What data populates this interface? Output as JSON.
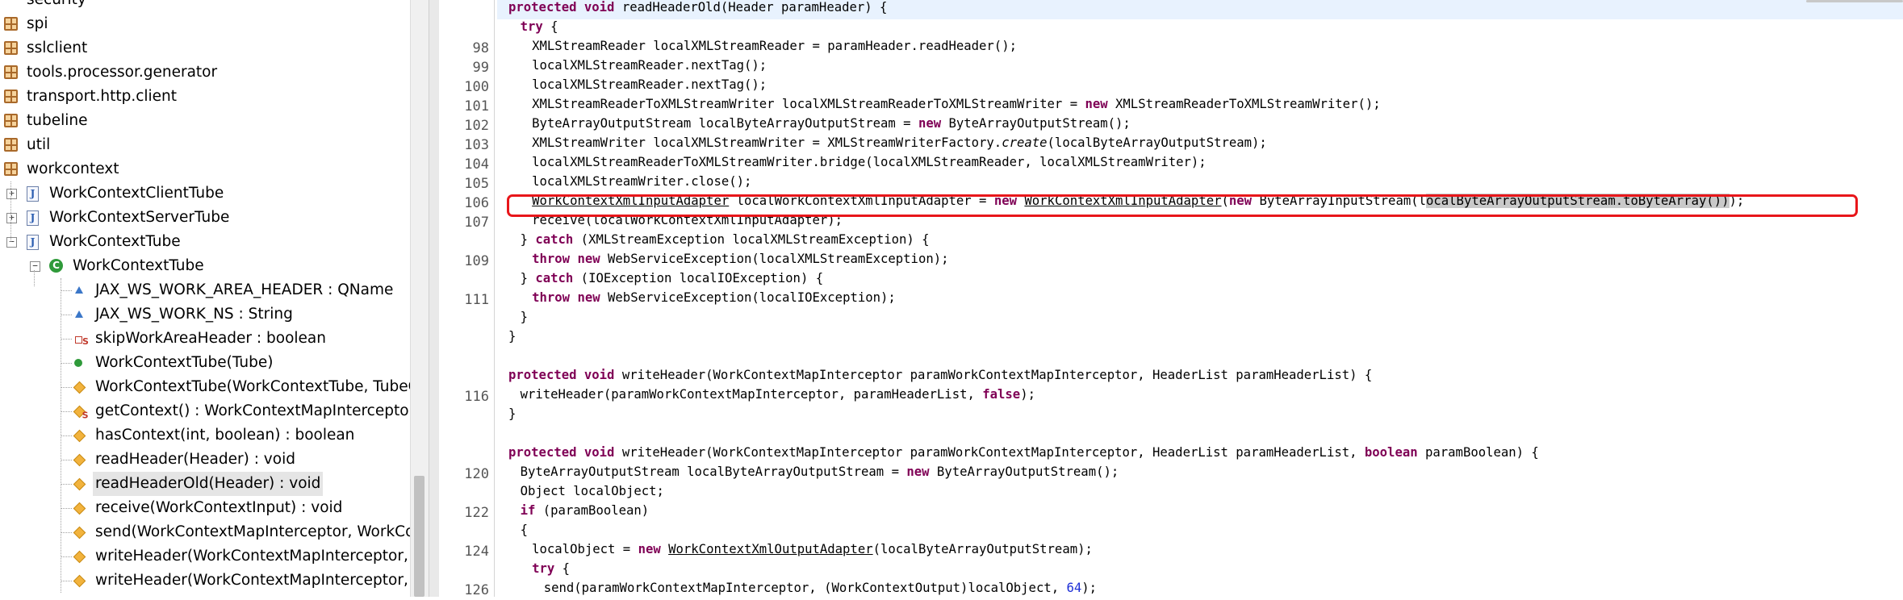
{
  "tree": {
    "items": [
      {
        "label": "security",
        "kind": "package",
        "cut": true
      },
      {
        "label": "spi",
        "kind": "package"
      },
      {
        "label": "sslclient",
        "kind": "package"
      },
      {
        "label": "tools.processor.generator",
        "kind": "package"
      },
      {
        "label": "transport.http.client",
        "kind": "package"
      },
      {
        "label": "tubeline",
        "kind": "package"
      },
      {
        "label": "util",
        "kind": "package"
      },
      {
        "label": "workcontext",
        "kind": "package"
      },
      {
        "label": "WorkContextClientTube",
        "kind": "java-file",
        "toggle": "+"
      },
      {
        "label": "WorkContextServerTube",
        "kind": "java-file",
        "toggle": "+"
      },
      {
        "label": "WorkContextTube",
        "kind": "java-file",
        "toggle": "-"
      },
      {
        "label": "WorkContextTube",
        "kind": "class",
        "toggle": "-"
      },
      {
        "label": "JAX_WS_WORK_AREA_HEADER : QName",
        "kind": "field-protected"
      },
      {
        "label": "JAX_WS_WORK_NS : String",
        "kind": "field-protected"
      },
      {
        "label": "skipWorkAreaHeader : boolean",
        "kind": "field-private-static"
      },
      {
        "label": "WorkContextTube(Tube)",
        "kind": "constructor-public"
      },
      {
        "label": "WorkContextTube(WorkContextTube, TubeC",
        "kind": "method-protected"
      },
      {
        "label": "getContext() : WorkContextMapInterceptor",
        "kind": "method-protected-static"
      },
      {
        "label": "hasContext(int, boolean) : boolean",
        "kind": "method-protected"
      },
      {
        "label": "readHeader(Header) : void",
        "kind": "method-protected"
      },
      {
        "label": "readHeaderOld(Header) : void",
        "kind": "method-protected",
        "selected": true
      },
      {
        "label": "receive(WorkContextInput) : void",
        "kind": "method-protected"
      },
      {
        "label": "send(WorkContextMapInterceptor, WorkCor",
        "kind": "method-protected"
      },
      {
        "label": "writeHeader(WorkContextMapInterceptor, H",
        "kind": "method-protected"
      },
      {
        "label": "writeHeader(WorkContextMapInterceptor, H",
        "kind": "method-protected"
      }
    ]
  },
  "editor": {
    "lines": [
      {
        "n": "",
        "indent": 0,
        "segs": [
          [
            "kw",
            "protected"
          ],
          [
            "t",
            " "
          ],
          [
            "kw",
            "void"
          ],
          [
            "t",
            " readHeaderOld(Header paramHeader) {"
          ]
        ]
      },
      {
        "n": "",
        "indent": 2,
        "segs": [
          [
            "kw",
            "try"
          ],
          [
            "t",
            " {"
          ]
        ]
      },
      {
        "n": "98",
        "indent": 4,
        "segs": [
          [
            "t",
            "XMLStreamReader localXMLStreamReader = paramHeader.readHeader();"
          ]
        ]
      },
      {
        "n": "99",
        "indent": 4,
        "segs": [
          [
            "t",
            "localXMLStreamReader.nextTag();"
          ]
        ]
      },
      {
        "n": "100",
        "indent": 4,
        "segs": [
          [
            "t",
            "localXMLStreamReader.nextTag();"
          ]
        ]
      },
      {
        "n": "101",
        "indent": 4,
        "segs": [
          [
            "t",
            "XMLStreamReaderToXMLStreamWriter localXMLStreamReaderToXMLStreamWriter = "
          ],
          [
            "kw",
            "new"
          ],
          [
            "t",
            " XMLStreamReaderToXMLStreamWriter();"
          ]
        ]
      },
      {
        "n": "102",
        "indent": 4,
        "segs": [
          [
            "t",
            "ByteArrayOutputStream localByteArrayOutputStream = "
          ],
          [
            "kw",
            "new"
          ],
          [
            "t",
            " ByteArrayOutputStream();"
          ]
        ]
      },
      {
        "n": "103",
        "indent": 4,
        "segs": [
          [
            "t",
            "XMLStreamWriter localXMLStreamWriter = XMLStreamWriterFactory."
          ],
          [
            "i",
            "create"
          ],
          [
            "t",
            "(localByteArrayOutputStream);"
          ]
        ]
      },
      {
        "n": "104",
        "indent": 4,
        "segs": [
          [
            "t",
            "localXMLStreamReaderToXMLStreamWriter.bridge(localXMLStreamReader, localXMLStreamWriter);"
          ]
        ]
      },
      {
        "n": "105",
        "indent": 4,
        "segs": [
          [
            "t",
            "localXMLStreamWriter.close();"
          ]
        ]
      },
      {
        "n": "106",
        "indent": 4,
        "segs": [
          [
            "u",
            "WorkContextXmlInputAdapter"
          ],
          [
            "t",
            " localWorkContextXmlInputAdapter = "
          ],
          [
            "kw",
            "new"
          ],
          [
            "t",
            " "
          ],
          [
            "u",
            "WorkContextXmlInputAdapter"
          ],
          [
            "t",
            "("
          ],
          [
            "kw",
            "new"
          ],
          [
            "t",
            " ByteArrayInputStream(l"
          ],
          [
            "hl",
            "ocalByteArrayOutputStream.toByteArray())"
          ],
          [
            "t",
            ");"
          ]
        ]
      },
      {
        "n": "107",
        "indent": 4,
        "segs": [
          [
            "t",
            "receive(localWorkContextXmlInputAdapter);"
          ]
        ]
      },
      {
        "n": "",
        "indent": 2,
        "segs": [
          [
            "t",
            "} "
          ],
          [
            "kw",
            "catch"
          ],
          [
            "t",
            " (XMLStreamException localXMLStreamException) {"
          ]
        ]
      },
      {
        "n": "109",
        "indent": 4,
        "segs": [
          [
            "kw",
            "throw"
          ],
          [
            "t",
            " "
          ],
          [
            "kw",
            "new"
          ],
          [
            "t",
            " WebServiceException(localXMLStreamException);"
          ]
        ]
      },
      {
        "n": "",
        "indent": 2,
        "segs": [
          [
            "t",
            "} "
          ],
          [
            "kw",
            "catch"
          ],
          [
            "t",
            " (IOException localIOException) {"
          ]
        ]
      },
      {
        "n": "111",
        "indent": 4,
        "segs": [
          [
            "kw",
            "throw"
          ],
          [
            "t",
            " "
          ],
          [
            "kw",
            "new"
          ],
          [
            "t",
            " WebServiceException(localIOException);"
          ]
        ]
      },
      {
        "n": "",
        "indent": 2,
        "segs": [
          [
            "t",
            "}"
          ]
        ]
      },
      {
        "n": "",
        "indent": 0,
        "segs": [
          [
            "t",
            "}"
          ]
        ]
      },
      {
        "n": "",
        "indent": 0,
        "segs": []
      },
      {
        "n": "",
        "indent": 0,
        "segs": [
          [
            "kw",
            "protected"
          ],
          [
            "t",
            " "
          ],
          [
            "kw",
            "void"
          ],
          [
            "t",
            " writeHeader(WorkContextMapInterceptor paramWorkContextMapInterceptor, HeaderList paramHeaderList) {"
          ]
        ]
      },
      {
        "n": "116",
        "indent": 2,
        "segs": [
          [
            "t",
            "writeHeader(paramWorkContextMapInterceptor, paramHeaderList, "
          ],
          [
            "kw",
            "false"
          ],
          [
            "t",
            ");"
          ]
        ]
      },
      {
        "n": "",
        "indent": 0,
        "segs": [
          [
            "t",
            "}"
          ]
        ]
      },
      {
        "n": "",
        "indent": 0,
        "segs": []
      },
      {
        "n": "",
        "indent": 0,
        "segs": [
          [
            "kw",
            "protected"
          ],
          [
            "t",
            " "
          ],
          [
            "kw",
            "void"
          ],
          [
            "t",
            " writeHeader(WorkContextMapInterceptor paramWorkContextMapInterceptor, HeaderList paramHeaderList, "
          ],
          [
            "kw",
            "boolean"
          ],
          [
            "t",
            " paramBoolean) {"
          ]
        ]
      },
      {
        "n": "120",
        "indent": 2,
        "segs": [
          [
            "t",
            "ByteArrayOutputStream localByteArrayOutputStream = "
          ],
          [
            "kw",
            "new"
          ],
          [
            "t",
            " ByteArrayOutputStream();"
          ]
        ]
      },
      {
        "n": "",
        "indent": 2,
        "segs": [
          [
            "t",
            "Object localObject;"
          ]
        ]
      },
      {
        "n": "122",
        "indent": 2,
        "segs": [
          [
            "kw",
            "if"
          ],
          [
            "t",
            " (paramBoolean)"
          ]
        ]
      },
      {
        "n": "",
        "indent": 2,
        "segs": [
          [
            "t",
            "{"
          ]
        ]
      },
      {
        "n": "124",
        "indent": 4,
        "segs": [
          [
            "t",
            "localObject = "
          ],
          [
            "kw",
            "new"
          ],
          [
            "t",
            " "
          ],
          [
            "u",
            "WorkContextXmlOutputAdapter"
          ],
          [
            "t",
            "(localByteArrayOutputStream);"
          ]
        ]
      },
      {
        "n": "",
        "indent": 4,
        "segs": [
          [
            "kw",
            "try"
          ],
          [
            "t",
            " {"
          ]
        ]
      },
      {
        "n": "126",
        "indent": 6,
        "segs": [
          [
            "t",
            "send(paramWorkContextMapInterceptor, (WorkContextOutput)localObject, "
          ],
          [
            "num",
            "64"
          ],
          [
            "t",
            ");"
          ]
        ]
      }
    ]
  },
  "colors": {
    "keyword": "#7f0055",
    "number": "#1d2fd6",
    "highlight_box": "#e8161a",
    "current_line": "#e8f2fe",
    "selection": "#c9c9c9"
  }
}
